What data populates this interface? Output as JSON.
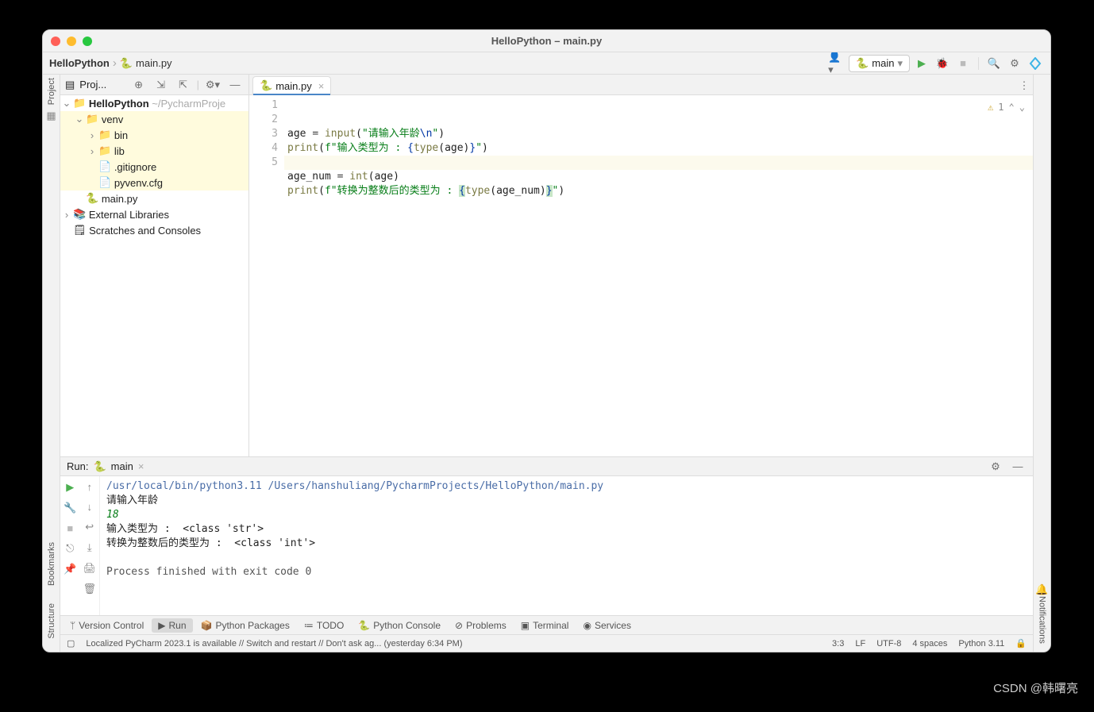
{
  "title": "HelloPython – main.py",
  "breadcrumb": {
    "root": "HelloPython",
    "file": "main.py"
  },
  "runcfg": "main",
  "project": {
    "header": "Proj...",
    "root": "HelloPython",
    "rootpath": "~/PycharmProje",
    "venv": "venv",
    "bin": "bin",
    "lib": "lib",
    "gitignore": ".gitignore",
    "pyvenv": "pyvenv.cfg",
    "mainpy": "main.py",
    "extlib": "External Libraries",
    "scratches": "Scratches and Consoles"
  },
  "tab": {
    "name": "main.py"
  },
  "inspection": {
    "warn": "1"
  },
  "code": {
    "l1a": "age ",
    "l1b": "=",
    "l1c": " ",
    "l1d": "input",
    "l1e": "(",
    "l1f": "\"请输入年龄",
    "l1g": "\\n",
    "l1h": "\"",
    "l1i": ")",
    "l2a": "print",
    "l2b": "(",
    "l2c": "f\"输入类型为 : ",
    "l2d": "{",
    "l2e": "type",
    "l2f": "(age)",
    "l2g": "}",
    "l2h": "\"",
    "l2i": ")",
    "l4a": "age_num ",
    "l4b": "=",
    "l4c": " ",
    "l4d": "int",
    "l4e": "(age)",
    "l5a": "print",
    "l5b": "(",
    "l5c": "f\"转换为整数后的类型为 : ",
    "l5d": "{",
    "l5e": "type",
    "l5f": "(age_num)",
    "l5g": "}",
    "l5h": "\"",
    "l5i": ")"
  },
  "run": {
    "label": "Run:",
    "tab": "main",
    "path": "/usr/local/bin/python3.11 /Users/hanshuliang/PycharmProjects/HelloPython/main.py",
    "prompt": "请输入年龄",
    "input": "18",
    "out1": "输入类型为 :  <class 'str'>",
    "out2": "转换为整数后的类型为 :  <class 'int'>",
    "exit": "Process finished with exit code 0"
  },
  "toolwins": {
    "vcs": "Version Control",
    "run": "Run",
    "pkg": "Python Packages",
    "todo": "TODO",
    "console": "Python Console",
    "problems": "Problems",
    "terminal": "Terminal",
    "services": "Services"
  },
  "status": {
    "msg": "Localized PyCharm 2023.1 is available // Switch and restart // Don't ask ag... (yesterday 6:34 PM)",
    "pos": "3:3",
    "sep": "LF",
    "enc": "UTF-8",
    "indent": "4 spaces",
    "sdk": "Python 3.11"
  },
  "rails": {
    "project": "Project",
    "bookmarks": "Bookmarks",
    "structure": "Structure",
    "notifications": "Notifications"
  },
  "watermark": "CSDN @韩曙亮"
}
